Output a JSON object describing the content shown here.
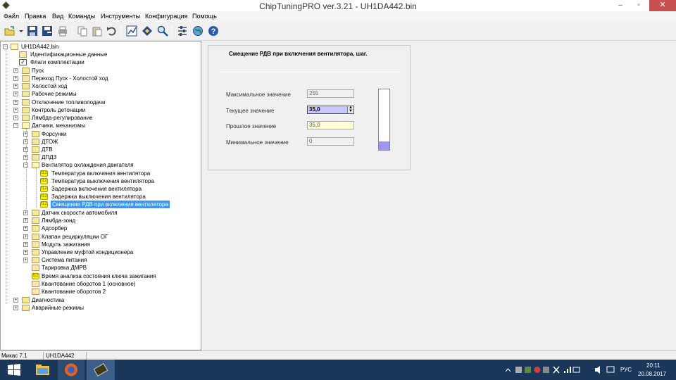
{
  "window": {
    "title": "ChipTuningPRO ver.3.21 - UH1DA442.bin",
    "minimize": "–",
    "maximize": "▫",
    "close": "✕"
  },
  "menu": [
    "Файл",
    "Правка",
    "Вид",
    "Команды",
    "Инструменты",
    "Конфигурация",
    "Помощь"
  ],
  "tree": {
    "root": "UH1DA442.bin",
    "items": [
      {
        "label": "Идентификационные данные"
      },
      {
        "label": "Флаги комплектации"
      },
      {
        "label": "Пуск"
      },
      {
        "label": "Переход Пуск - Холостой ход"
      },
      {
        "label": "Холостой ход"
      },
      {
        "label": "Рабочие режимы"
      },
      {
        "label": "Отключение топливоподачи"
      },
      {
        "label": "Контроль детонации"
      },
      {
        "label": "Лямбда-регулирование"
      },
      {
        "label": "Датчики, механизмы"
      },
      {
        "label": "Форсунки"
      },
      {
        "label": "ДТОЖ"
      },
      {
        "label": "ДТВ"
      },
      {
        "label": "ДПДЗ"
      },
      {
        "label": "Вентилятор охлаждения двигателя"
      },
      {
        "label": "Температура включения вентилятора"
      },
      {
        "label": "Температура выключения вентилятора"
      },
      {
        "label": "Задержка включения вентилятора"
      },
      {
        "label": "Задержка выключения вентилятора"
      },
      {
        "label": "Смещение РДВ при включения вентилятора"
      },
      {
        "label": "Датчик скорости автомобиля"
      },
      {
        "label": "Лямбда-зонд"
      },
      {
        "label": "Адсорбер"
      },
      {
        "label": "Клапан рециркуляции ОГ"
      },
      {
        "label": "Модуль зажигания"
      },
      {
        "label": "Управление муфтой кондиционера"
      },
      {
        "label": "Система питания"
      },
      {
        "label": "Тарировка ДМРВ"
      },
      {
        "label": "Время анализа состояния ключа зажигания"
      },
      {
        "label": "Квантование оборотов 1 (основное)"
      },
      {
        "label": "Квантование оборотов 2"
      },
      {
        "label": "Диагностика"
      },
      {
        "label": "Аварийные режимы"
      }
    ]
  },
  "param": {
    "title": "Смещение РДВ при включения вентилятора, шаг.",
    "max_label": "Максимальное значение",
    "max_value": "255",
    "current_label": "Текущее значение",
    "current_value": "35,0",
    "past_label": "Прошлое значение",
    "past_value": "35,0",
    "min_label": "Минимальное значение",
    "min_value": "0",
    "gauge_fraction": 0.137
  },
  "status": {
    "ecu": "Микас 7.1",
    "file": "UH1DA442"
  },
  "tray": {
    "lang": "РУС",
    "time": "20:11",
    "date": "20.08.2017"
  },
  "colors": {
    "accent_selection": "#3399ff",
    "taskbar": "#1a3658",
    "gauge": "#9999ee"
  }
}
